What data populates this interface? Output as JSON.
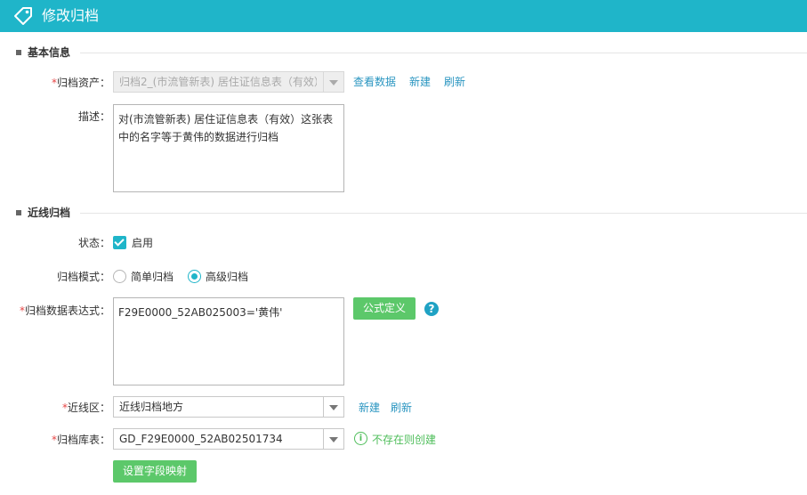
{
  "header": {
    "title": "修改归档",
    "icon": "tag-icon"
  },
  "basic_section": {
    "title": "基本信息"
  },
  "archive_asset": {
    "label": "归档资产：",
    "value": "归档2_(市流管新表) 居住证信息表（有效）",
    "links": {
      "view": "查看数据",
      "new": "新建",
      "refresh": "刷新"
    }
  },
  "description": {
    "label": "描述：",
    "value": "对(市流管新表) 居住证信息表（有效）这张表中的名字等于黄伟的数据进行归档"
  },
  "nearline_section": {
    "title": "近线归档"
  },
  "status": {
    "label": "状态：",
    "checked": true,
    "option": "启用"
  },
  "mode": {
    "label": "归档模式：",
    "options": [
      "简单归档",
      "高级归档"
    ],
    "selected": "高级归档"
  },
  "expression": {
    "label": "归档数据表达式：",
    "value": "F29E0000_52AB025003='黄伟'",
    "button": "公式定义",
    "help": "?"
  },
  "nearline_zone": {
    "label": "近线区：",
    "value": "近线归档地方",
    "links": {
      "new": "新建",
      "refresh": "刷新"
    }
  },
  "archive_table": {
    "label": "归档库表：",
    "value": "GD_F29E0000_52AB02501734",
    "hint": "不存在则创建",
    "hint_icon": "i"
  },
  "mapping_button": "设置字段映射",
  "colors": {
    "accent": "#1fb5c9",
    "link": "#2b96c1",
    "button": "#5cc86a",
    "required": "#e64545",
    "hint": "#4fbe5b"
  }
}
